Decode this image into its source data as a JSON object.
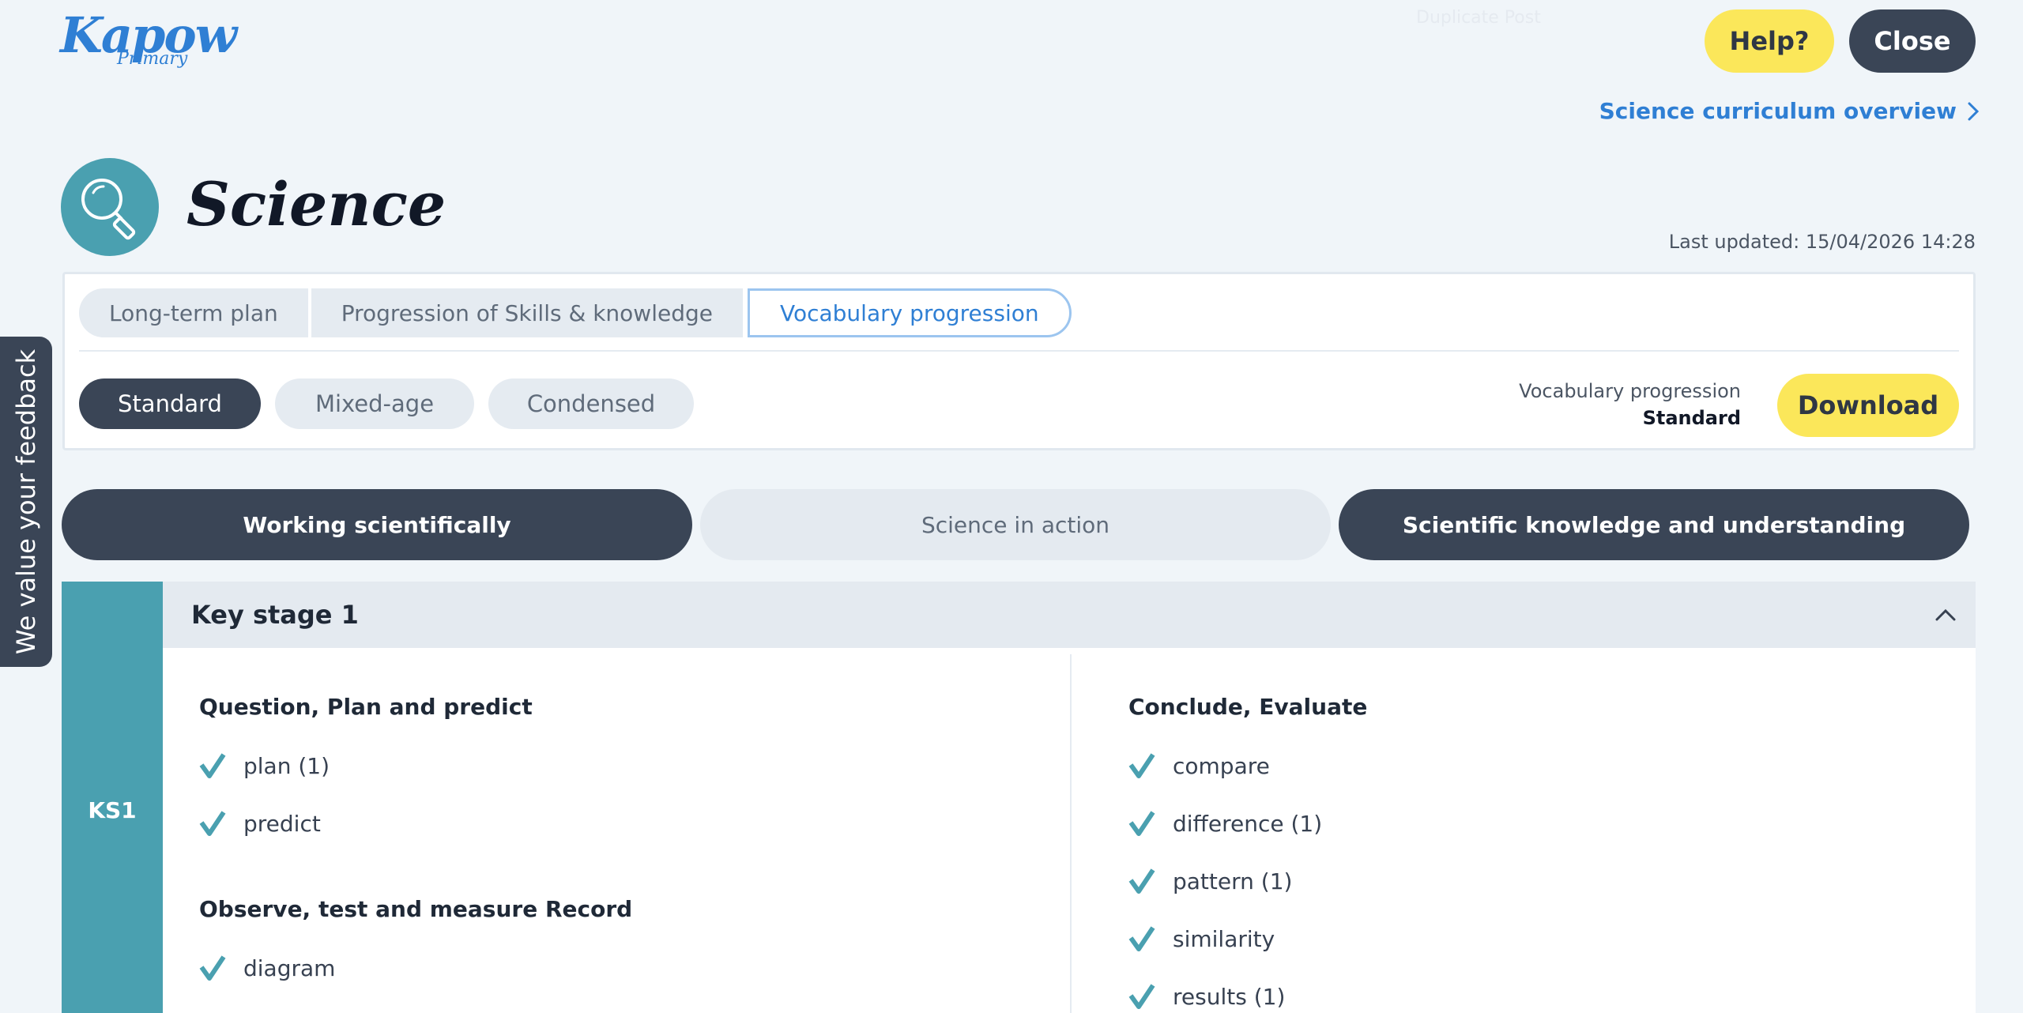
{
  "header": {
    "logo_main": "Kapow",
    "logo_sub": "Primary",
    "faint_text": "Duplicate Post",
    "help_label": "Help?",
    "close_label": "Close",
    "overview_link": "Science curriculum overview"
  },
  "feedback": {
    "label": "We value your feedback"
  },
  "subject": {
    "title": "Science",
    "icon": "magnifying-glass-icon",
    "last_updated": "Last updated: 15/04/2026 14:28"
  },
  "tabs": [
    {
      "label": "Long-term plan"
    },
    {
      "label": "Progression of Skills & knowledge"
    },
    {
      "label": "Vocabulary progression",
      "active": true
    }
  ],
  "variants": [
    {
      "label": "Standard",
      "selected": true
    },
    {
      "label": "Mixed-age"
    },
    {
      "label": "Condensed"
    }
  ],
  "download": {
    "info_line1": "Vocabulary progression",
    "info_line2": "Standard",
    "button_label": "Download"
  },
  "categories": [
    {
      "label": "Working scientifically",
      "active": true
    },
    {
      "label": "Science in action",
      "active": false
    },
    {
      "label": "Scientific knowledge and understanding",
      "active": true
    }
  ],
  "key_stage": {
    "title": "Key stage 1",
    "badge": "KS1",
    "left_column": {
      "group1_title": "Question, Plan and predict",
      "group1_items": [
        "plan (1)",
        "predict"
      ],
      "group2_title": "Observe, test and measure Record",
      "group2_items": [
        "diagram"
      ]
    },
    "right_column": {
      "group1_title": "Conclude, Evaluate",
      "group1_items": [
        "compare",
        "difference (1)",
        "pattern (1)",
        "similarity",
        "results (1)"
      ]
    }
  },
  "colors": {
    "accent_blue": "#2f7fd4",
    "teal": "#4aa0b0",
    "dark": "#3a4556",
    "yellow": "#fbe75a"
  }
}
